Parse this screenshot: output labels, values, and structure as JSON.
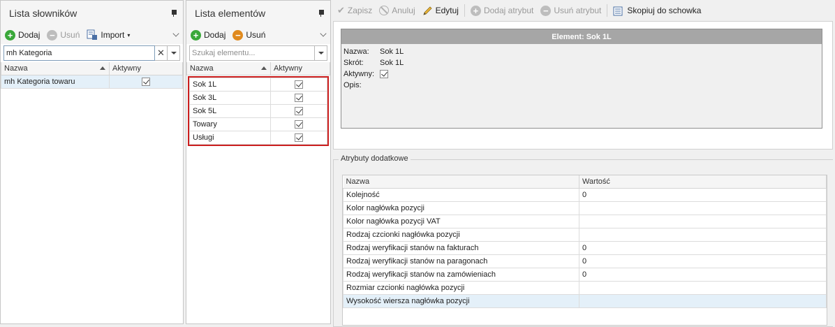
{
  "panel1": {
    "title": "Lista słowników",
    "toolbar": {
      "add": "Dodaj",
      "remove": "Usuń",
      "import": "Import"
    },
    "search_value": "mh Kategoria",
    "columns": [
      "Nazwa",
      "Aktywny"
    ],
    "rows": [
      {
        "name": "mh Kategoria towaru",
        "active": true
      }
    ]
  },
  "panel2": {
    "title": "Lista elementów",
    "toolbar": {
      "add": "Dodaj",
      "remove": "Usuń"
    },
    "search_placeholder": "Szukaj elementu...",
    "columns": [
      "Nazwa",
      "Aktywny"
    ],
    "rows": [
      {
        "name": "Sok 1L",
        "active": true
      },
      {
        "name": "Sok 3L",
        "active": true
      },
      {
        "name": "Sok 5L",
        "active": true
      },
      {
        "name": "Towary",
        "active": true
      },
      {
        "name": "Usługi",
        "active": true
      }
    ]
  },
  "right_toolbar": {
    "save": "Zapisz",
    "cancel": "Anuluj",
    "edit": "Edytuj",
    "add_attr": "Dodaj atrybut",
    "remove_attr": "Usuń atrybut",
    "copy": "Skopiuj do schowka"
  },
  "element": {
    "header": "Element: Sok 1L",
    "name_label": "Nazwa:",
    "name_value": "Sok 1L",
    "short_label": "Skrót:",
    "short_value": "Sok 1L",
    "active_label": "Aktywny:",
    "active": true,
    "desc_label": "Opis:"
  },
  "attributes": {
    "group_label": "Atrybuty dodatkowe",
    "columns": [
      "Nazwa",
      "Wartość"
    ],
    "rows": [
      {
        "name": "Kolejność",
        "value": "0"
      },
      {
        "name": "Kolor nagłówka pozycji",
        "value": ""
      },
      {
        "name": "Kolor nagłówka pozycji VAT",
        "value": ""
      },
      {
        "name": "Rodzaj czcionki nagłówka pozycji",
        "value": ""
      },
      {
        "name": "Rodzaj weryfikacji stanów na fakturach",
        "value": "0"
      },
      {
        "name": "Rodzaj weryfikacji stanów na paragonach",
        "value": "0"
      },
      {
        "name": "Rodzaj weryfikacji stanów na zamówieniach",
        "value": "0"
      },
      {
        "name": "Rozmiar czcionki nagłówka pozycji",
        "value": ""
      },
      {
        "name": "Wysokość wiersza nagłówka pozycji",
        "value": ""
      }
    ]
  },
  "colors": {
    "highlight_border": "#cc1f1f",
    "selected_row": "#e4f0f9",
    "header_bar": "#a6a6a6"
  }
}
